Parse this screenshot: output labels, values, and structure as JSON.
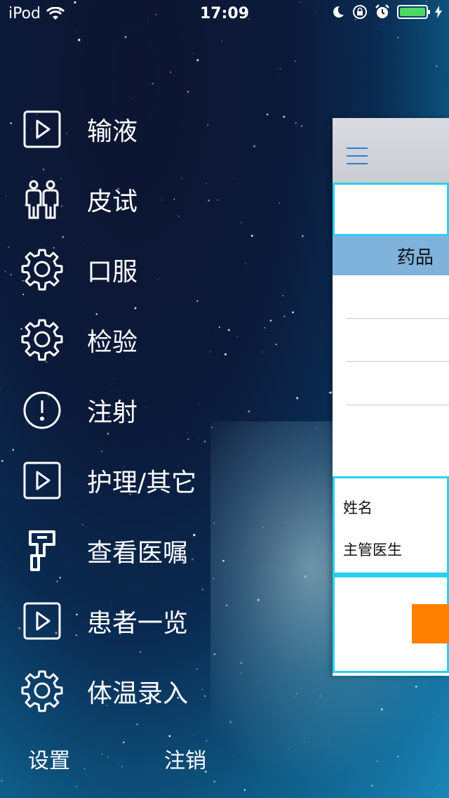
{
  "status_bar": {
    "carrier": "iPod",
    "time": "17:09"
  },
  "menu": {
    "items": [
      {
        "label": "输液",
        "icon": "play-icon"
      },
      {
        "label": "皮试",
        "icon": "people-icon"
      },
      {
        "label": "口服",
        "icon": "gear-icon"
      },
      {
        "label": "检验",
        "icon": "gear-icon"
      },
      {
        "label": "注射",
        "icon": "exclamation-icon"
      },
      {
        "label": "护理/其它",
        "icon": "play-icon"
      },
      {
        "label": "查看医嘱",
        "icon": "key-icon"
      },
      {
        "label": "患者一览",
        "icon": "play-icon"
      },
      {
        "label": "体温录入",
        "icon": "gear-icon"
      }
    ]
  },
  "footer": {
    "settings_label": "设置",
    "logout_label": "注销"
  },
  "panel": {
    "column_header": "药品",
    "info_name_label": "姓名",
    "info_doctor_label": "主管医生"
  },
  "colors": {
    "accent": "#2ad0ef",
    "header_bg": "#7fb3dc",
    "orange": "#ff8000",
    "battery": "#4cd964"
  }
}
